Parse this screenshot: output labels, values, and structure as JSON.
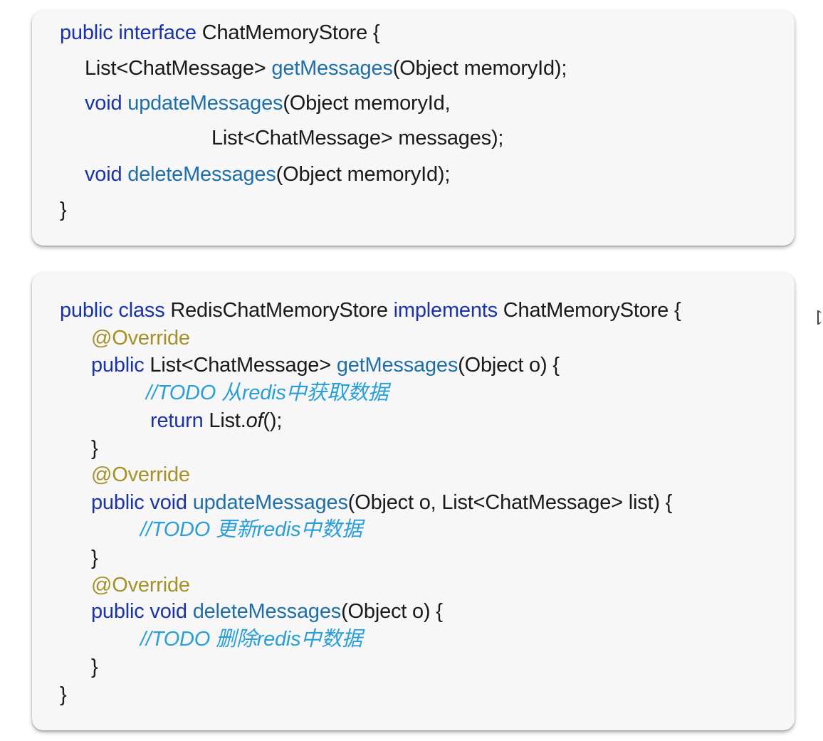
{
  "interface_block": {
    "l1": {
      "kw1": "public interface",
      "name": " ChatMemoryStore {"
    },
    "l2": {
      "type": "List<ChatMessage> ",
      "fn": "getMessages",
      "args": "(Object memoryId);"
    },
    "l3": {
      "kw": "void ",
      "fn": "updateMessages",
      "args": "(Object memoryId,"
    },
    "l4": {
      "args": "List<ChatMessage> messages);"
    },
    "l5": {
      "kw": "void ",
      "fn": "deleteMessages",
      "args": "(Object memoryId);"
    },
    "l6": {
      "text": "}"
    }
  },
  "class_block": {
    "l1": {
      "kw1": "public class",
      "name": " RedisChatMemoryStore ",
      "kw2": "implements",
      "iface": " ChatMemoryStore {"
    },
    "l2": {
      "ann": "@Override"
    },
    "l3": {
      "kw": "public",
      "type": " List<ChatMessage> ",
      "fn": "getMessages",
      "args": "(Object o) {"
    },
    "l4": {
      "comment": "//TODO 从redis中获取数据"
    },
    "l5": {
      "kw": "return",
      "pre": " List.",
      "it": "of",
      "post": "();"
    },
    "l6": {
      "text": "}"
    },
    "l7": {
      "ann": "@Override"
    },
    "l8": {
      "kw": "public void ",
      "fn": "updateMessages",
      "args": "(Object o, List<ChatMessage> list) {"
    },
    "l9": {
      "comment": "//TODO 更新redis中数据"
    },
    "l10": {
      "text": "}"
    },
    "l11": {
      "ann": "@Override"
    },
    "l12": {
      "kw": "public void ",
      "fn": "deleteMessages",
      "args": "(Object o) {"
    },
    "l13": {
      "comment": "//TODO 删除redis中数据"
    },
    "l14": {
      "text": "}"
    },
    "l15": {
      "text": "}"
    }
  }
}
